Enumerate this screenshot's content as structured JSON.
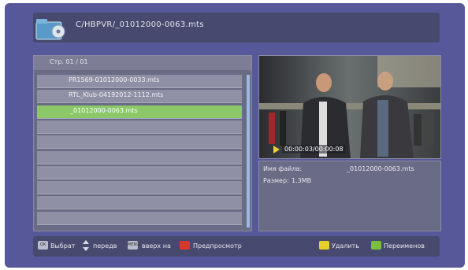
{
  "header": {
    "path": "C/HBPVR/_01012000-0063.mts"
  },
  "list": {
    "page_label": "Стр.  01 / 01",
    "items": [
      {
        "name": "PR1569-01012000-0033.mts"
      },
      {
        "name": "RTL_Klub-04192012-1112.mts"
      },
      {
        "name": "_01012000-0063.mts",
        "selected": true
      },
      {
        "name": ""
      },
      {
        "name": ""
      },
      {
        "name": ""
      },
      {
        "name": ""
      },
      {
        "name": ""
      },
      {
        "name": ""
      },
      {
        "name": ""
      }
    ]
  },
  "preview": {
    "timecode": "00:00:03/00:00:08"
  },
  "info": {
    "filename_label": "Имя файла:",
    "filename_value": "_01012000-0063.mts",
    "size_label": "Размер:",
    "size_value": "1.3MB"
  },
  "footer": {
    "ok_key": "OK",
    "select_label": "Выбрат",
    "move_label": "передв",
    "menu_key": "MENU",
    "up_label": "вверх на",
    "preview_label": "Предпросмотр",
    "delete_label": "Удалить",
    "rename_label": "Переименов"
  },
  "colors": {
    "background": "#57589a",
    "selected_row": "#8cc86a",
    "scroll_thumb": "#9ab8e8",
    "red_key": "#d83a2a",
    "yellow_key": "#e8d02a",
    "green_key": "#7cc040"
  }
}
